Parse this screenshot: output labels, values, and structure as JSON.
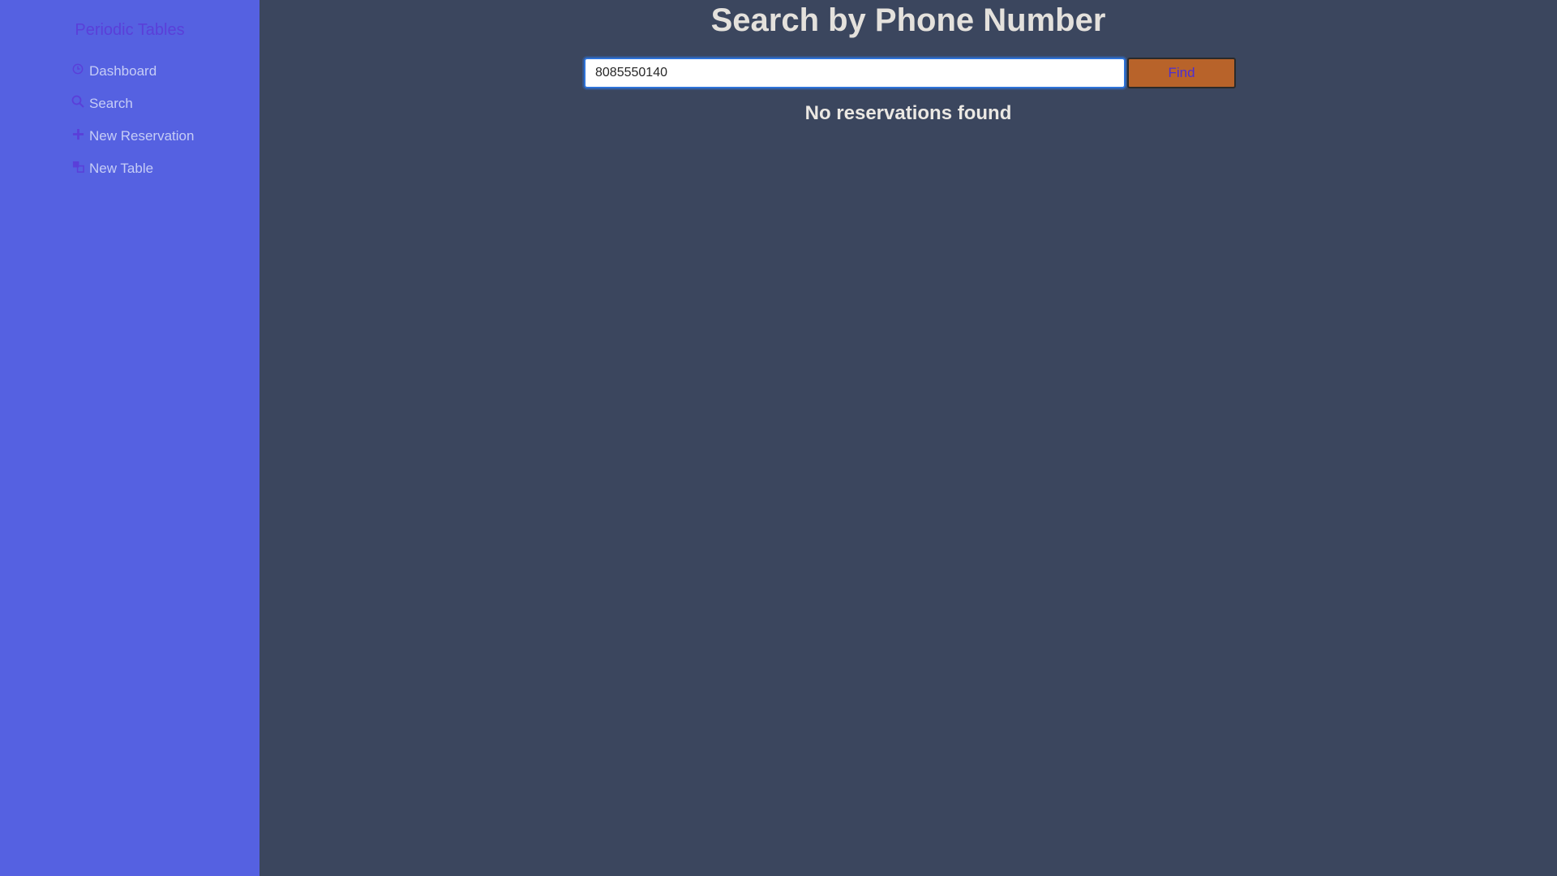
{
  "app": {
    "brand": "Periodic Tables"
  },
  "sidebar": {
    "items": [
      {
        "label": "Dashboard",
        "icon": "clock-icon"
      },
      {
        "label": "Search",
        "icon": "search-icon"
      },
      {
        "label": "New Reservation",
        "icon": "plus-icon"
      },
      {
        "label": "New Table",
        "icon": "layers-icon"
      }
    ]
  },
  "main": {
    "title": "Search by Phone Number",
    "search": {
      "value": "8085550140",
      "placeholder": ""
    },
    "find_label": "Find",
    "result_message": "No reservations found"
  },
  "colors": {
    "sidebar_bg": "#5561e1",
    "main_bg": "#3b465e",
    "brand_text": "#5a3fd9",
    "icon": "#5a3fd9",
    "button_bg": "#b8632a",
    "button_text": "#4b2fd4"
  }
}
